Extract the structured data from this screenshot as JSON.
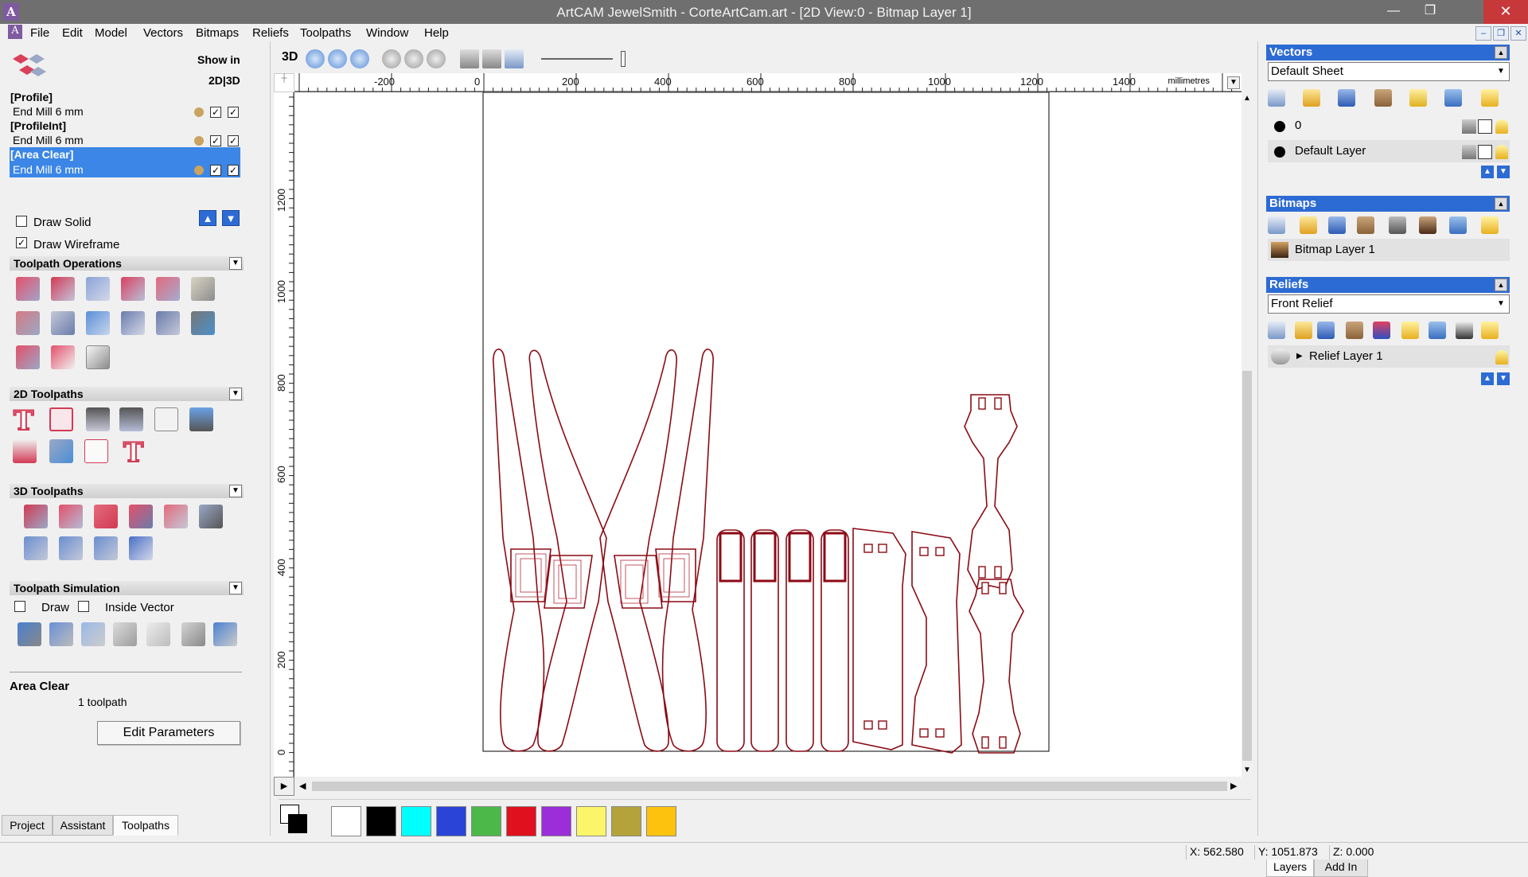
{
  "window": {
    "title": "ArtCAM JewelSmith - CorteArtCam.art - [2D View:0 - Bitmap Layer 1]",
    "minimize": "—",
    "maximize": "❐",
    "close": "✕"
  },
  "menu": [
    "File",
    "Edit",
    "Model",
    "Vectors",
    "Bitmaps",
    "Reliefs",
    "Toolpaths",
    "Window",
    "Help"
  ],
  "mdi_buttons": [
    "–",
    "❐",
    "✕"
  ],
  "left_panel": {
    "show_in_label": "Show in",
    "show_in_modes": "2D|3D",
    "toolpaths": [
      {
        "group": "[Profile]",
        "tool": "End Mill 6 mm",
        "selected": false
      },
      {
        "group": "[ProfileInt]",
        "tool": "End Mill 6 mm",
        "selected": false
      },
      {
        "group": "[Area Clear]",
        "tool": "End Mill 6 mm",
        "selected": true
      }
    ],
    "draw_solid": "Draw Solid",
    "draw_solid_checked": false,
    "draw_wireframe": "Draw Wireframe",
    "draw_wireframe_checked": true,
    "sections": {
      "toolpath_operations": "Toolpath Operations",
      "toolpaths_2d": "2D Toolpaths",
      "toolpaths_3d": "3D Toolpaths",
      "toolpath_simulation": "Toolpath Simulation"
    },
    "sim_draw": "Draw",
    "sim_inside_vector": "Inside Vector",
    "selected_name": "Area Clear",
    "selected_count": "1 toolpath",
    "edit_parameters": "Edit Parameters",
    "tabs": [
      "Project",
      "Assistant",
      "Toolpaths"
    ],
    "active_tab": "Toolpaths"
  },
  "view_toolbar": {
    "mode_3d": "3D"
  },
  "ruler": {
    "unit": "millimetres",
    "h_ticks": [
      "-200",
      "0",
      "200",
      "400",
      "600",
      "800",
      "1000",
      "1200",
      "1400"
    ],
    "v_ticks": [
      "1200",
      "1000",
      "800",
      "600",
      "400",
      "200",
      "0"
    ]
  },
  "palette": {
    "colors": [
      "#ffffff",
      "#000000",
      "#00ffff",
      "#2b44d8",
      "#4db84a",
      "#e0101e",
      "#9b2ed8",
      "#fcf56a",
      "#b3a33a",
      "#fcc20e"
    ]
  },
  "right_panel": {
    "vectors_title": "Vectors",
    "vectors_sheet": "Default Sheet",
    "vector_layers": [
      "0",
      "Default Layer"
    ],
    "bitmaps_title": "Bitmaps",
    "bitmap_layers": [
      "Bitmap Layer 1"
    ],
    "reliefs_title": "Reliefs",
    "relief_select": "Front Relief",
    "relief_layers": [
      "Relief Layer 1"
    ],
    "tabs": [
      "Layers",
      "Add In"
    ],
    "active_tab": "Layers"
  },
  "status": {
    "x": "X: 562.580",
    "y": "Y: 1051.873",
    "z": "Z: 0.000"
  }
}
